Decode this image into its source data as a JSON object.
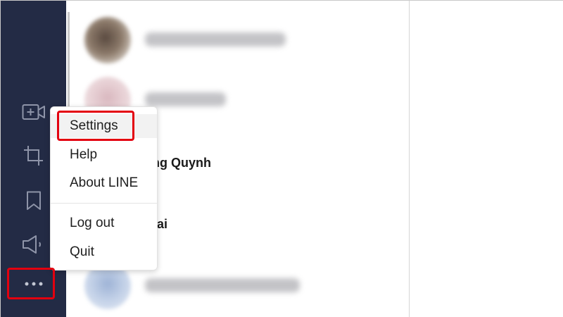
{
  "sidebar": {
    "icons": [
      {
        "name": "video-call-icon"
      },
      {
        "name": "crop-icon"
      },
      {
        "name": "bookmark-icon"
      },
      {
        "name": "speaker-icon"
      },
      {
        "name": "more-icon"
      }
    ],
    "icon_color": "#8e94a8"
  },
  "chats": {
    "partial_name_1": "ang Quynh",
    "partial_name_2": "otai"
  },
  "menu": {
    "items": [
      {
        "label": "Settings"
      },
      {
        "label": "Help"
      },
      {
        "label": "About LINE"
      },
      {
        "label": "Log out"
      },
      {
        "label": "Quit"
      }
    ]
  },
  "colors": {
    "sidebar_bg": "#232b45",
    "annotation_red": "#e3000f"
  }
}
